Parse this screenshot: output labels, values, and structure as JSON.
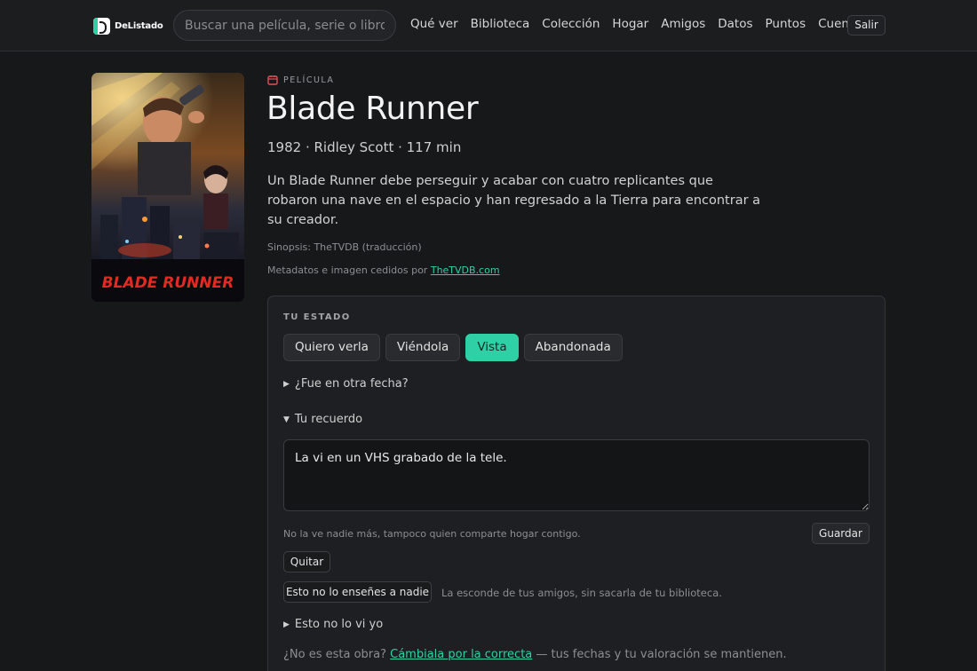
{
  "app": {
    "logo_text": "DeListado",
    "search_placeholder": "Buscar una película, serie o libro...",
    "nav": [
      "Qué ver",
      "Biblioteca",
      "Colección",
      "Hogar",
      "Amigos",
      "Datos",
      "Puntos",
      "Cuenta"
    ],
    "logout_label": "Salir"
  },
  "work": {
    "type_label": "PELÍCULA",
    "title": "Blade Runner",
    "meta": "1982 · Ridley Scott · 117 min",
    "synopsis": "Un Blade Runner debe perseguir y acabar con cuatro replicantes que robaron una nave en el espacio y han regresado a la Tierra para encontrar a su creador.",
    "synopsis_source": "Sinopsis: TheTVDB (traducción)",
    "metadata_credit": "Metadatos e imagen cedidos por",
    "metadata_link": "TheTVDB.com",
    "poster_text": "BLADE RUNNER"
  },
  "status_panel": {
    "heading": "TU ESTADO",
    "options": [
      "Quiero verla",
      "Viéndola",
      "Vista",
      "Abandonada"
    ],
    "selected": "Vista",
    "other_date_label": "¿Fue en otra fecha?",
    "memory_label": "Tu recuerdo",
    "memory_value": "La vi en un VHS grabado de la tele.",
    "visibility_hint": "No la ve nadie más, tampoco quien comparte hogar contigo.",
    "save_label": "Guardar",
    "remove_label": "Quitar",
    "hide_label": "Esto no lo enseñes a nadie",
    "hide_hint": "La esconde de tus amigos, sin sacarla de tu biblioteca.",
    "not_seen_label": "Esto no lo vi yo",
    "wrong_prefix": "¿No es esta obra?",
    "wrong_link": "Cámbiala por la correcta",
    "wrong_suffix": "— tus fechas y tu valoración se mantienen."
  },
  "colors": {
    "accent": "#2fd0a6",
    "background": "#17181a",
    "panel": "#1e1f22"
  }
}
